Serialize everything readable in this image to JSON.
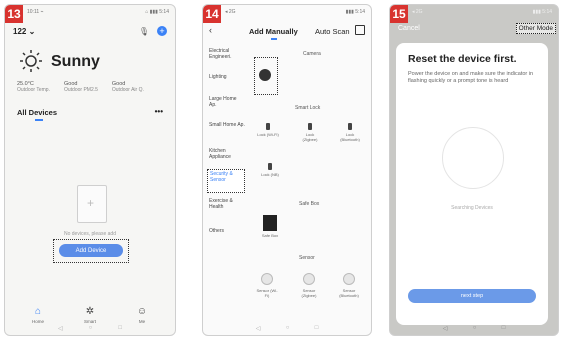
{
  "screens": [
    {
      "step": "13",
      "status_left": "10:11 ⌁",
      "status_right": "⌂ ▮▮▮ 5:14",
      "home_name": "122 ⌄",
      "weather": "Sunny",
      "stats": [
        {
          "value": "25.0°C",
          "label": "Outdoor Temp."
        },
        {
          "value": "Good",
          "label": "Outdoor PM2.5"
        },
        {
          "value": "Good",
          "label": "Outdoor Air Q."
        }
      ],
      "devices_tab": "All Devices",
      "more": "•••",
      "empty_text": "No devices, please add",
      "add_device": "Add Device",
      "nav": [
        {
          "icon": "home-icon",
          "label": "Home"
        },
        {
          "icon": "smart-icon",
          "label": "Smart"
        },
        {
          "icon": "me-icon",
          "label": "Me"
        }
      ]
    },
    {
      "step": "14",
      "status_left": "◂ 2G",
      "status_right": "▮▮▮ 5:14",
      "back": "‹",
      "tab_manual": "Add Manually",
      "tab_scan": "Auto Scan",
      "categories": [
        "Electrical Engineeri.",
        "Lighting",
        "Large Home Ap.",
        "Small Home Ap.",
        "Kitchen Appliance",
        "Security & Sensor",
        "Exercise & Health",
        "Others"
      ],
      "selected_category": "Security & Sensor",
      "sections": {
        "camera": "Camera",
        "smart_lock": "Smart Lock",
        "safe_box": "Safe Box",
        "sensor": "Sensor"
      },
      "lock_items": [
        "Lock (Wi-Fi)",
        "Lock (Zigbee)",
        "Lock (Bluetooth)",
        "Lock (NB)"
      ],
      "safe_item": "Safe Box",
      "sensor_items": [
        "Sensor (Wi-Fi)",
        "Sensor (Zigbee)",
        "Sensor (Bluetooth)"
      ]
    },
    {
      "step": "15",
      "status_left": "◂ 2G",
      "status_right": "▮▮▮ 5:14",
      "cancel": "Cancel",
      "other_mode": "Other Mode",
      "title": "Reset the device first.",
      "description": "Power the device on and make sure the indicator in flashing quickly or a prompt tone is heard",
      "searching": "Searching Devices",
      "next": "next step"
    }
  ]
}
